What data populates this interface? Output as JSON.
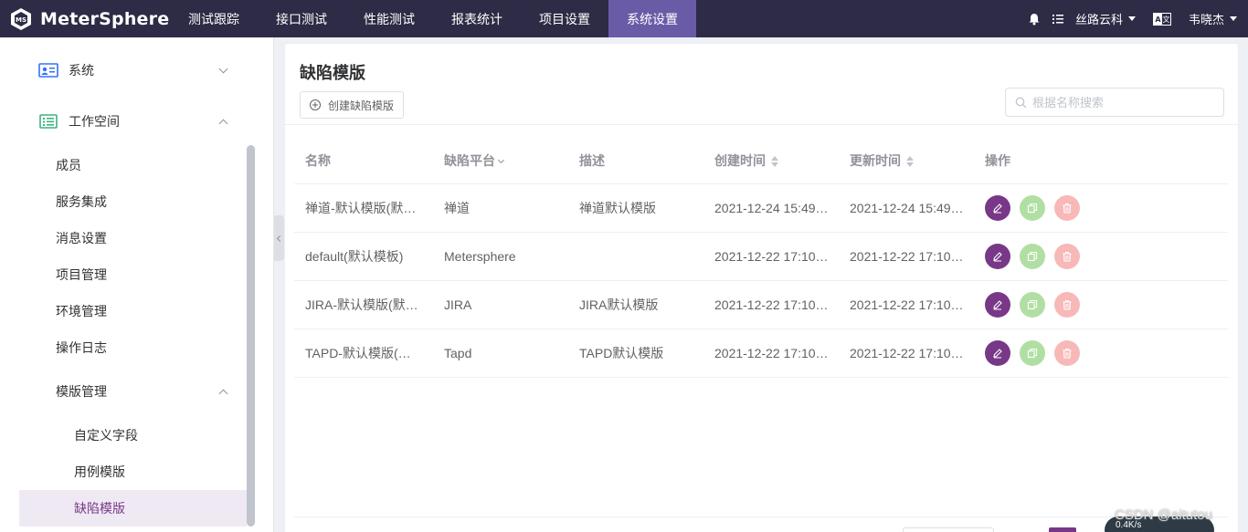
{
  "app": {
    "logo_text": "MeterSphere"
  },
  "topnav": {
    "items": [
      {
        "label": "测试跟踪"
      },
      {
        "label": "接口测试"
      },
      {
        "label": "性能测试"
      },
      {
        "label": "报表统计"
      },
      {
        "label": "项目设置"
      },
      {
        "label": "系统设置",
        "active": true
      }
    ],
    "workspace": "丝路云科",
    "user": "韦晓杰"
  },
  "sidebar": {
    "groups": [
      {
        "label": "系统",
        "icon": "id-card-icon",
        "expanded": false
      },
      {
        "label": "工作空间",
        "icon": "list-icon",
        "expanded": true
      }
    ],
    "workspace_items": [
      {
        "label": "成员"
      },
      {
        "label": "服务集成"
      },
      {
        "label": "消息设置"
      },
      {
        "label": "项目管理"
      },
      {
        "label": "环境管理"
      },
      {
        "label": "操作日志"
      }
    ],
    "template_group": {
      "label": "模版管理",
      "expanded": true
    },
    "template_items": [
      {
        "label": "自定义字段"
      },
      {
        "label": "用例模版"
      },
      {
        "label": "缺陷模版",
        "active": true
      }
    ]
  },
  "main": {
    "title": "缺陷模版",
    "create_button": "创建缺陷模版",
    "search_placeholder": "根据名称搜索",
    "columns": {
      "name": "名称",
      "platform": "缺陷平台",
      "description": "描述",
      "create_time": "创建时间",
      "update_time": "更新时间",
      "operations": "操作"
    },
    "rows": [
      {
        "name": "禅道-默认模版(默认模板)",
        "platform": "禅道",
        "description": "禅道默认模版",
        "create_time": "2021-12-24 15:49…",
        "update_time": "2021-12-24 15:49…"
      },
      {
        "name": "default(默认模板)",
        "platform": "Metersphere",
        "description": "",
        "create_time": "2021-12-22 17:10…",
        "update_time": "2021-12-22 17:10…"
      },
      {
        "name": "JIRA-默认模版(默认模板)",
        "platform": "JIRA",
        "description": "JIRA默认模版",
        "create_time": "2021-12-22 17:10…",
        "update_time": "2021-12-22 17:10…"
      },
      {
        "name": "TAPD-默认模版(默认模板)",
        "platform": "Tapd",
        "description": "TAPD默认模版",
        "create_time": "2021-12-22 17:10…",
        "update_time": "2021-12-22 17:10…"
      }
    ]
  },
  "overlay": {
    "watermark": "CSDN @aitutou",
    "speed": "0.4K/s"
  },
  "colors": {
    "topbar": "#2d2b45",
    "nav_active": "#6a5ba7",
    "brand_purple": "#783887",
    "copy_green": "#b1dfa3",
    "delete_pink": "#f8b8b8"
  }
}
